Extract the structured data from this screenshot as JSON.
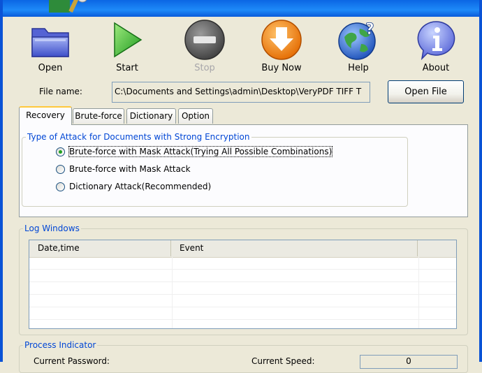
{
  "toolbar": {
    "open": "Open",
    "start": "Start",
    "stop": "Stop",
    "buy_now": "Buy Now",
    "help": "Help",
    "about": "About"
  },
  "file": {
    "label": "File name:",
    "value": "C:\\Documents and Settings\\admin\\Desktop\\VeryPDF TIFF T",
    "open_button": "Open File"
  },
  "tabs": [
    "Recovery",
    "Brute-force",
    "Dictionary",
    "Option"
  ],
  "attack": {
    "title": "Type of Attack for Documents with Strong Encryption",
    "options": [
      "Brute-force with Mask Attack(Trying All Possible Combinations)",
      "Brute-force with Mask Attack",
      "Dictionary Attack(Recommended)"
    ],
    "selected_index": 0
  },
  "log": {
    "title": "Log Windows",
    "columns": [
      "Date,time",
      "Event"
    ]
  },
  "process": {
    "title": "Process Indicator",
    "current_password_label": "Current Password:",
    "current_speed_label": "Current Speed:",
    "current_speed_value": "0"
  },
  "colors": {
    "frame_blue": "#0A53D6",
    "window_bg": "#ECE9D8",
    "group_title": "#0046D5",
    "radio_check": "#21A121",
    "active_tab_accent": "#FFC83C"
  }
}
